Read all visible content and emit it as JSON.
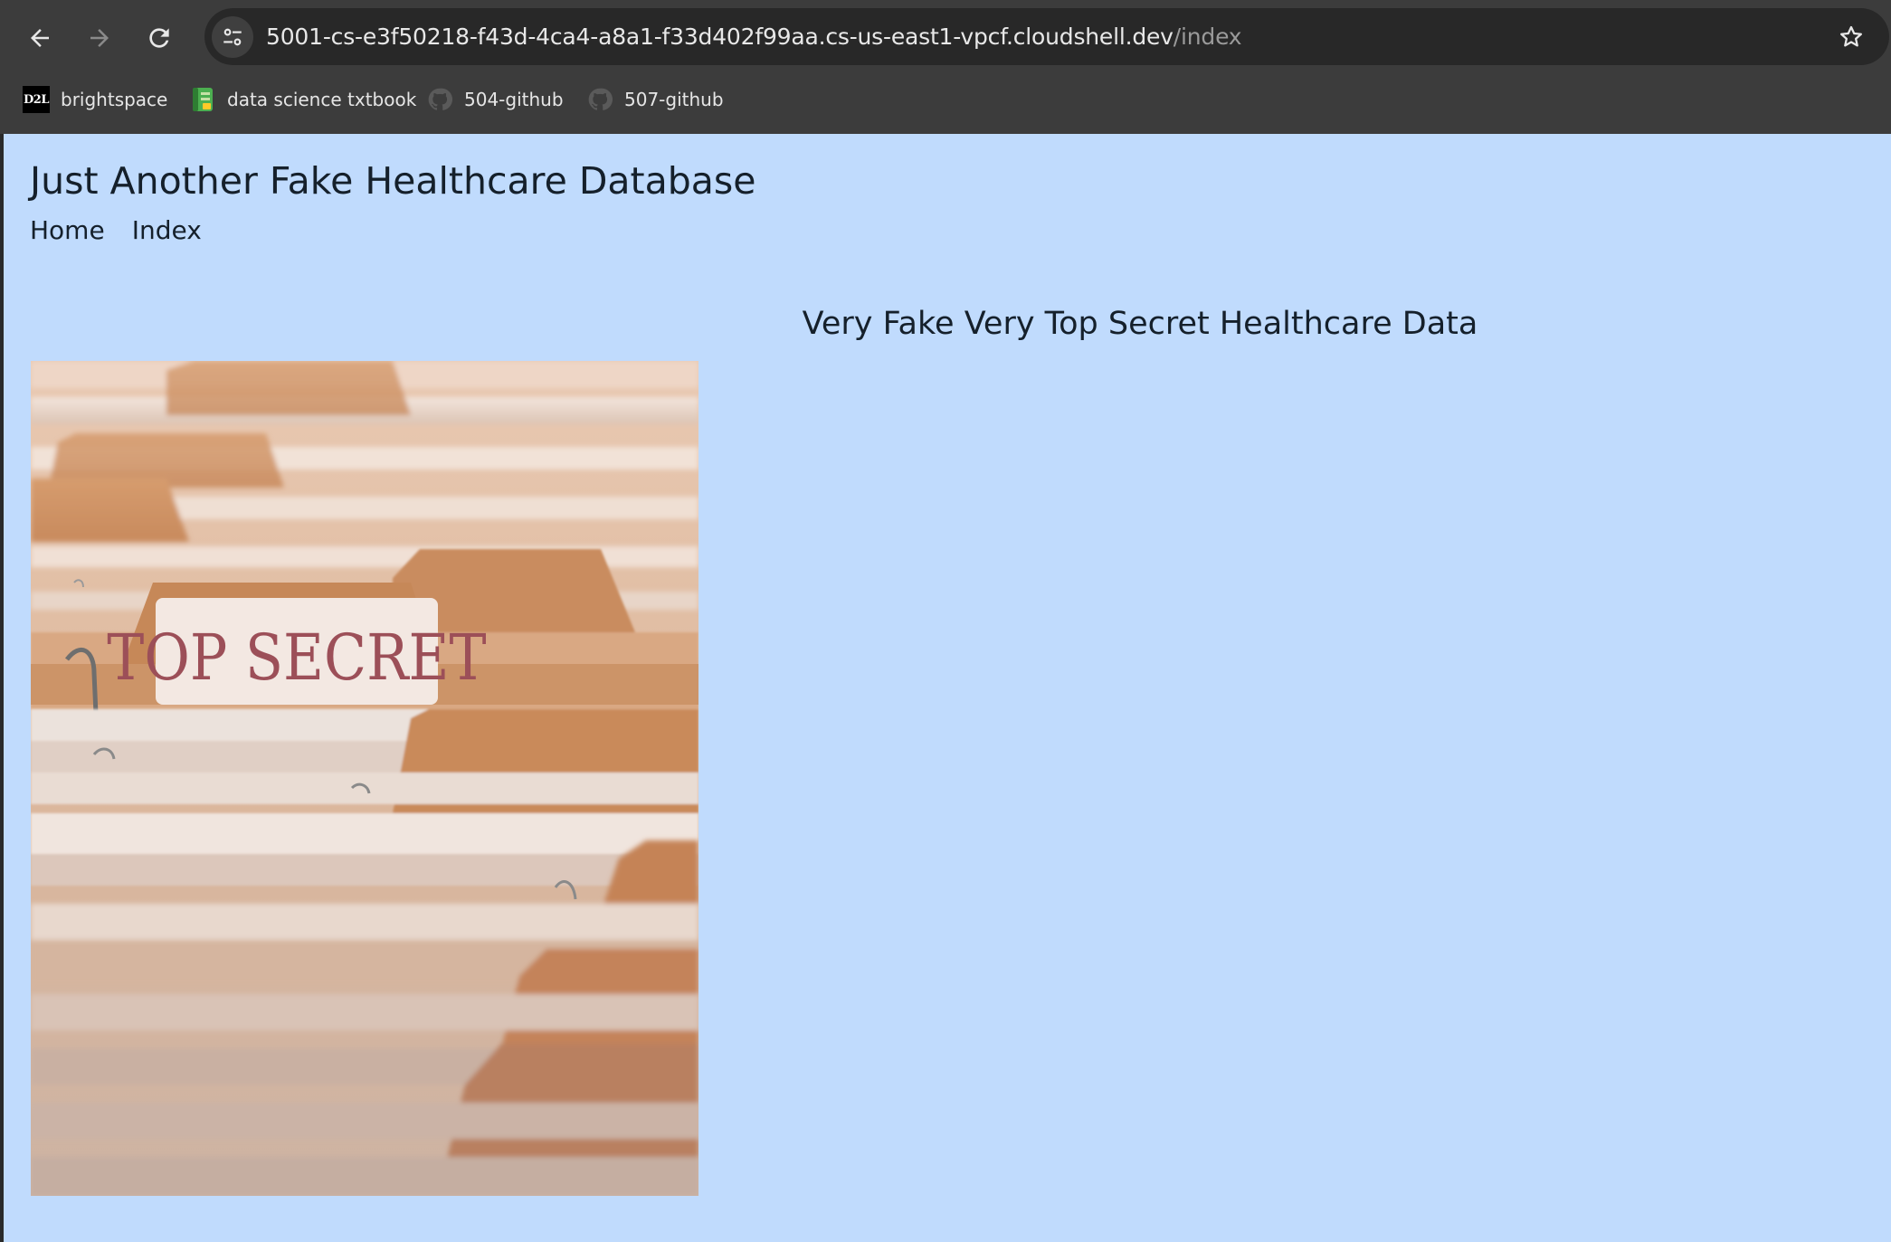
{
  "browser": {
    "url_host": "5001-cs-e3f50218-f43d-4ca4-a8a1-f33d402f99aa.cs-us-east1-vpcf.cloudshell.dev",
    "url_path": "/index",
    "icons": {
      "back": "arrow-left-icon",
      "forward": "arrow-right-icon",
      "reload": "reload-icon",
      "site_info": "tune-icon",
      "bookmark_star": "star-icon"
    },
    "bookmarks": [
      {
        "label": "brightspace",
        "icon": "d2l-icon",
        "icon_text": "D2L"
      },
      {
        "label": "data science txtbook",
        "icon": "notebook-icon"
      },
      {
        "label": "504-github",
        "icon": "github-icon"
      },
      {
        "label": "507-github",
        "icon": "github-icon"
      }
    ]
  },
  "page": {
    "site_title": "Just Another Fake Healthcare Database",
    "nav": [
      {
        "label": "Home"
      },
      {
        "label": "Index"
      }
    ],
    "heading": "Very Fake Very Top Secret Healthcare Data",
    "image": {
      "tab_text": "TOP SECRET"
    }
  },
  "colors": {
    "page_background": "#c0dbfd",
    "chrome_background": "#3c3c3c",
    "text": "#15202b"
  }
}
